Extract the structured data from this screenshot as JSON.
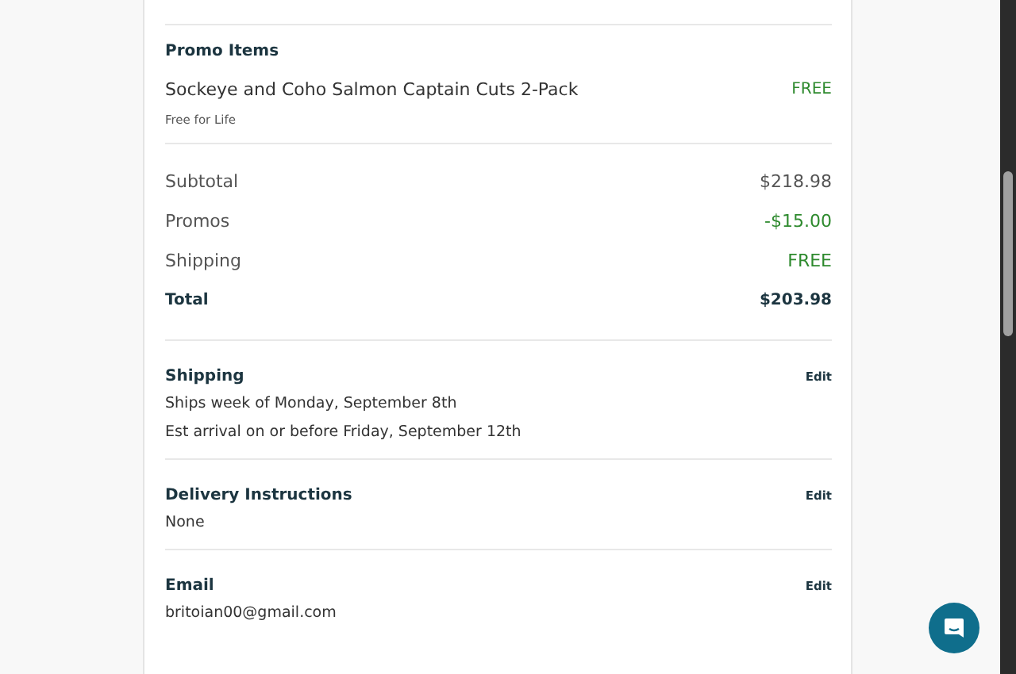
{
  "promo_items": {
    "heading": "Promo Items",
    "items": [
      {
        "name": "Sockeye and Coho Salmon Captain Cuts 2-Pack",
        "price": "FREE",
        "note": "Free for Life"
      }
    ]
  },
  "summary": [
    {
      "label": "Subtotal",
      "amount": "$218.98",
      "kind": "normal"
    },
    {
      "label": "Promos",
      "amount": "-$15.00",
      "kind": "discount"
    },
    {
      "label": "Shipping",
      "amount": "FREE",
      "kind": "discount"
    },
    {
      "label": "Total",
      "amount": "$203.98",
      "kind": "total"
    }
  ],
  "sections": [
    {
      "heading": "Shipping",
      "action": "Edit",
      "lines": [
        "Ships week of Monday, September 8th",
        "Est arrival on or before Friday, September 12th"
      ]
    },
    {
      "heading": "Delivery Instructions",
      "action": "Edit",
      "lines": [
        "None"
      ]
    },
    {
      "heading": "Email",
      "action": "Edit",
      "lines": [
        "britoian00@gmail.com"
      ]
    }
  ]
}
